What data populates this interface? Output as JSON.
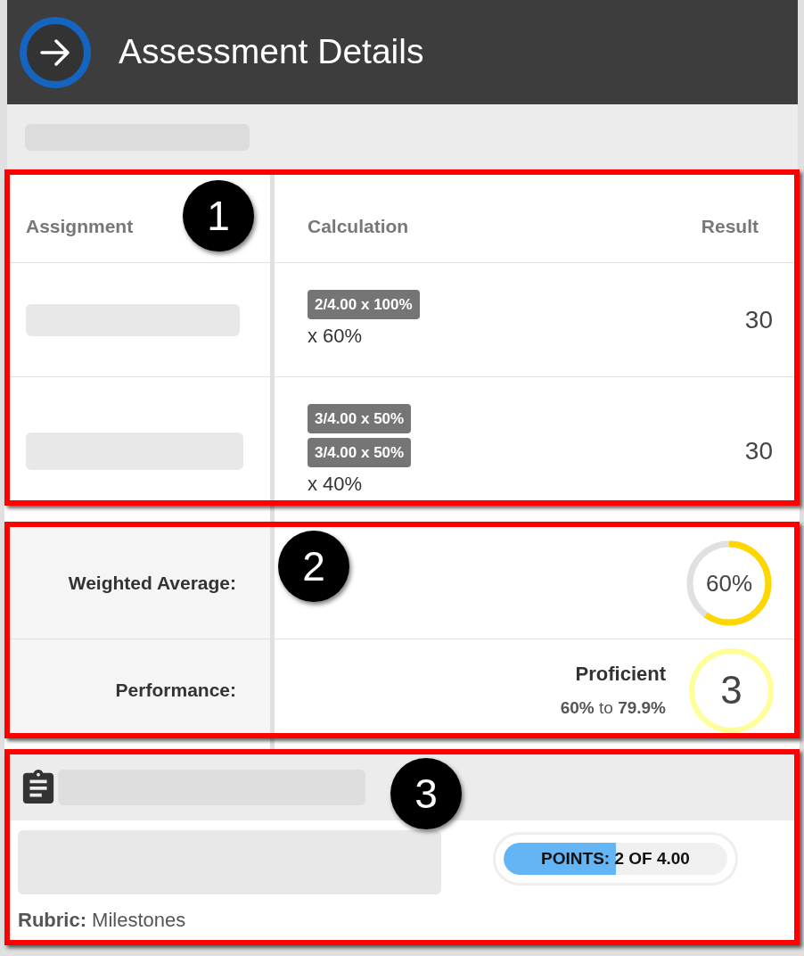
{
  "header": {
    "title": "Assessment Details"
  },
  "assignments": {
    "callout": "1",
    "columns": [
      "Assignment",
      "Calculation",
      "Result"
    ],
    "rows": [
      {
        "calculations": [
          "2/4.00 x 100%"
        ],
        "weight": "x 60%",
        "result": "30"
      },
      {
        "calculations": [
          "3/4.00 x 50%",
          "3/4.00 x 50%"
        ],
        "weight": "x 40%",
        "result": "30"
      }
    ]
  },
  "summary": {
    "callout": "2",
    "weighted_average": {
      "label": "Weighted Average:",
      "value": "60%",
      "level": 0.6
    },
    "performance": {
      "label": "Performance:",
      "rating": "Proficient",
      "range": "**60%** to **79.9%**",
      "score": "3"
    }
  },
  "standard": {
    "callout": "3",
    "rubric": "**Rubric:** Milestones",
    "points": {
      "text": "POINTS: 2 OF 4.00",
      "level": 0.5
    }
  }
}
